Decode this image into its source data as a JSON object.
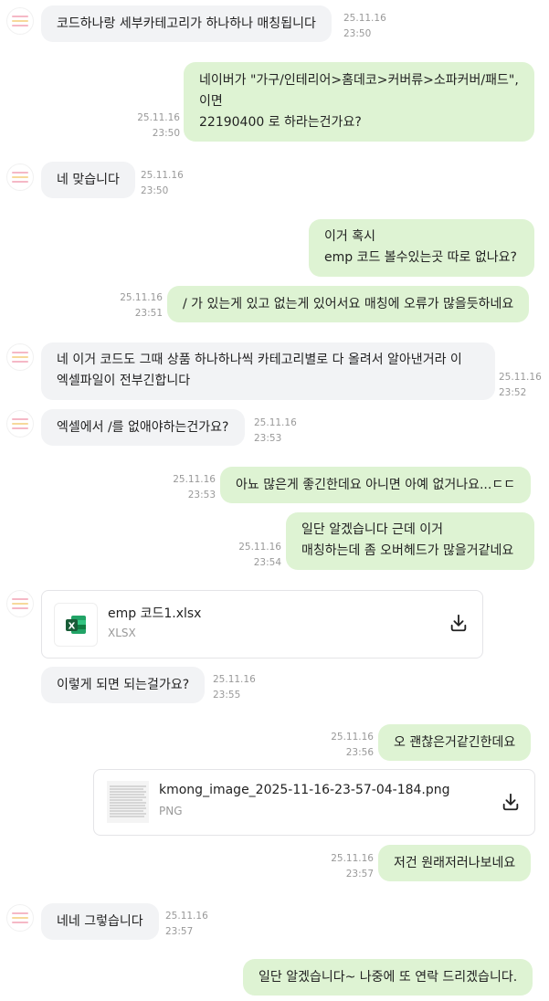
{
  "colors": {
    "incoming_bubble": "#f2f3f5",
    "outgoing_bubble": "#def3d3",
    "timestamp": "#999999"
  },
  "messages": [
    {
      "text": "코드하나랑 세부카테고리가 하나하나 매칭됩니다",
      "date": "25.11.16",
      "time": "23:50"
    },
    {
      "lines": [
        "네이버가 \"가구/인테리어>홈데코>커버류>소파커버/패드\",",
        "이면",
        "22190400 로 하라는건가요?"
      ],
      "date": "25.11.16",
      "time": "23:50"
    },
    {
      "text": "네 맞습니다",
      "date": "25.11.16",
      "time": "23:50"
    },
    {
      "lines": [
        "이거 혹시",
        "emp 코드 볼수있는곳 따로 없나요?"
      ]
    },
    {
      "text": "/ 가 있는게 있고 없는게 있어서요 매칭에 오류가 많을듯하네요",
      "date": "25.11.16",
      "time": "23:51"
    },
    {
      "lines": [
        "네 이거 코드도 그때 상품 하나하나씩 카테고리별로 다 올려서 알아낸거라 이",
        "엑셀파일이 전부긴합니다"
      ],
      "date": "25.11.16",
      "time": "23:52"
    },
    {
      "text": "엑셀에서 /를 없애야하는건가요?",
      "date": "25.11.16",
      "time": "23:53"
    },
    {
      "text": "아뇨 많은게 좋긴한데요 아니면 아예 없거나요...ㄷㄷ",
      "date": "25.11.16",
      "time": "23:53"
    },
    {
      "lines": [
        "일단 알겠습니다 근데 이거",
        "매칭하는데 좀 오버헤드가 많을거같네요"
      ],
      "date": "25.11.16",
      "time": "23:54"
    },
    {
      "file_name": "emp 코드1.xlsx",
      "file_ext": "XLSX",
      "icon": "excel-icon"
    },
    {
      "text": "이렇게 되면 되는걸가요?",
      "date": "25.11.16",
      "time": "23:55"
    },
    {
      "text": "오 괜찮은거같긴한데요",
      "date": "25.11.16",
      "time": "23:56"
    },
    {
      "file_name": "kmong_image_2025-11-16-23-57-04-184.png",
      "file_ext": "PNG",
      "icon": "image-thumbnail"
    },
    {
      "text": "저건 원래저러나보네요",
      "date": "25.11.16",
      "time": "23:57"
    },
    {
      "text": "네네 그렇습니다",
      "date": "25.11.16",
      "time": "23:57"
    },
    {
      "text": "일단 알겠습니다~ 나중에 또 연락 드리겠습니다."
    }
  ]
}
